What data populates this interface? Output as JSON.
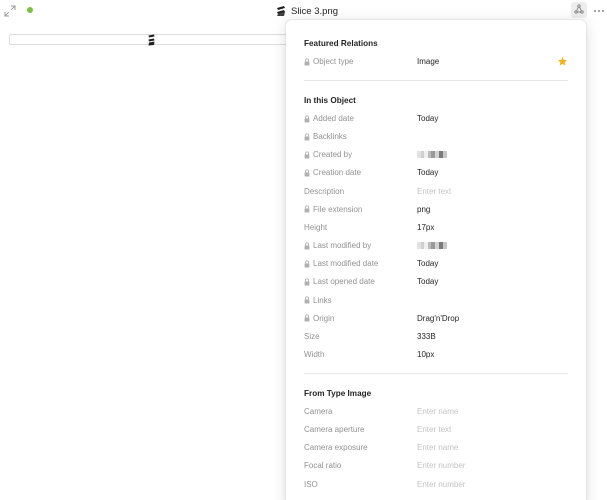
{
  "header": {
    "title": "Slice 3.png",
    "sync_color": "#7ac043"
  },
  "panel": {
    "featured": {
      "title": "Featured Relations",
      "rows": [
        {
          "name": "Object type",
          "value": "Image",
          "locked": true,
          "starred": true
        }
      ]
    },
    "object": {
      "title": "In this Object",
      "rows": [
        {
          "name": "Added date",
          "value": "Today",
          "locked": true
        },
        {
          "name": "Backlinks",
          "value": "",
          "locked": true
        },
        {
          "name": "Created by",
          "value": "",
          "locked": true,
          "avatar": true
        },
        {
          "name": "Creation date",
          "value": "Today",
          "locked": true
        },
        {
          "name": "Description",
          "value": "Enter text",
          "locked": false,
          "placeholder": true
        },
        {
          "name": "File extension",
          "value": "png",
          "locked": true
        },
        {
          "name": "Height",
          "value": "17px",
          "locked": false
        },
        {
          "name": "Last modified by",
          "value": "",
          "locked": true,
          "avatar": true
        },
        {
          "name": "Last modified date",
          "value": "Today",
          "locked": true
        },
        {
          "name": "Last opened date",
          "value": "Today",
          "locked": true
        },
        {
          "name": "Links",
          "value": "",
          "locked": true
        },
        {
          "name": "Origin",
          "value": "Drag'n'Drop",
          "locked": true
        },
        {
          "name": "Size",
          "value": "333B",
          "locked": false
        },
        {
          "name": "Width",
          "value": "10px",
          "locked": false
        }
      ]
    },
    "type_image": {
      "title": "From Type Image",
      "rows": [
        {
          "name": "Camera",
          "value": "Enter name",
          "placeholder": true
        },
        {
          "name": "Camera aperture",
          "value": "Enter text",
          "placeholder": true
        },
        {
          "name": "Camera exposure",
          "value": "Enter name",
          "placeholder": true
        },
        {
          "name": "Focal ratio",
          "value": "Enter number",
          "placeholder": true
        },
        {
          "name": "ISO",
          "value": "Enter number",
          "placeholder": true
        }
      ]
    },
    "colors": {
      "star": "#f3b31f",
      "lock": "#b0b0b0"
    },
    "icons": {
      "lock": "lock-icon",
      "star": "star-icon",
      "relations": "relations-icon",
      "more": "more-icon",
      "expand": "expand-icon"
    }
  }
}
